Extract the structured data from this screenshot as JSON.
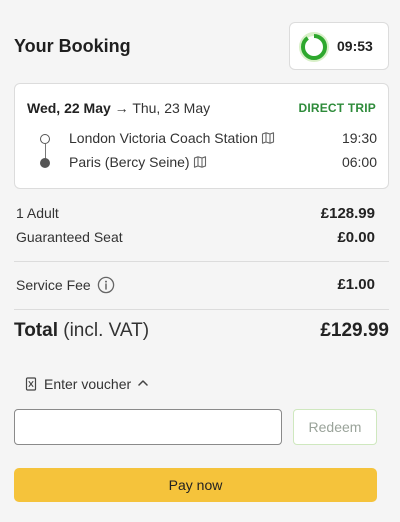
{
  "booking": {
    "title": "Your Booking",
    "timer": {
      "time_left": "09:53",
      "ring_color": "#2ea82e",
      "icon": "countdown-ring-icon"
    }
  },
  "trip": {
    "date_depart": "Wed, 22 May",
    "arrow": "→",
    "date_arrive": "Thu, 23 May",
    "badge": "DIRECT TRIP",
    "badge_color": "#2e8b3a",
    "stops": [
      {
        "name": "London Victoria Coach Station",
        "time": "19:30",
        "icon": "map-icon"
      },
      {
        "name": "Paris (Bercy Seine)",
        "time": "06:00",
        "icon": "map-icon"
      }
    ]
  },
  "pricing": {
    "rows": [
      {
        "label": "1 Adult",
        "amount": "£128.99"
      },
      {
        "label": "Guaranteed Seat",
        "amount": "£0.00"
      }
    ],
    "service_fee": {
      "label": "Service Fee",
      "amount": "£1.00",
      "icon": "info-icon"
    },
    "total": {
      "label_bold": "Total",
      "label_rest": " (incl. VAT)",
      "amount": "£129.99"
    }
  },
  "voucher": {
    "toggle_label": "Enter voucher",
    "icon": "voucher-icon",
    "chevron": "chevron-up-icon",
    "input_value": "",
    "input_placeholder": "",
    "redeem_label": "Redeem"
  },
  "pay": {
    "label": "Pay now",
    "color": "#f5c33b"
  }
}
